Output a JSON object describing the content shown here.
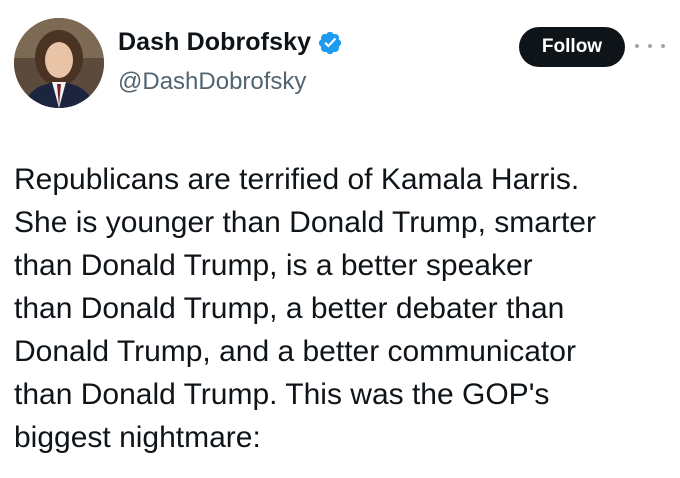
{
  "author": {
    "display_name": "Dash Dobrofsky",
    "handle": "@DashDobrofsky",
    "verified_icon": "verified-badge-icon",
    "verified_color": "#1d9bf0"
  },
  "actions": {
    "follow_label": "Follow",
    "more_icon": "more-options-icon"
  },
  "tweet": {
    "lines": [
      "Republicans are terrified of Kamala Harris.",
      "She is younger than Donald Trump, smarter",
      "than Donald Trump, is a better speaker",
      "than Donald Trump, a better debater than",
      "Donald Trump, and a better communicator",
      "than Donald Trump. This was the GOP's",
      "biggest nightmare:"
    ]
  },
  "colors": {
    "text": "#0f1419",
    "secondary_text": "#536471",
    "button_bg": "#0f1419",
    "button_text": "#ffffff"
  }
}
